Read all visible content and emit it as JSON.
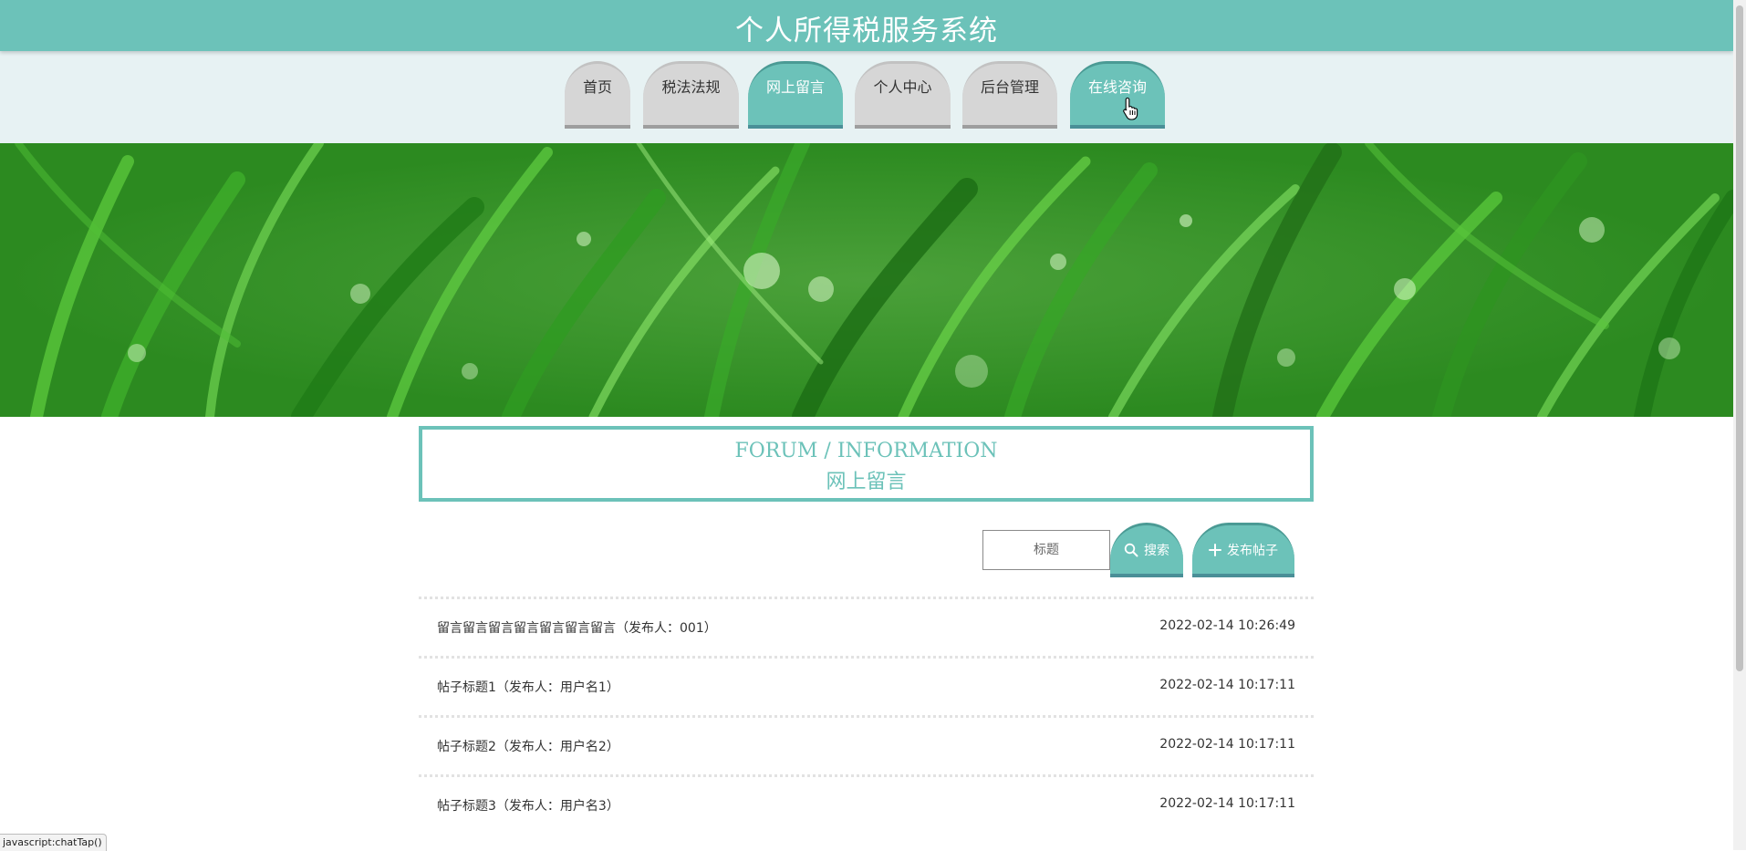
{
  "header": {
    "title": "个人所得税服务系统"
  },
  "nav": {
    "tabs": [
      {
        "label": "首页"
      },
      {
        "label": "税法法规"
      },
      {
        "label": "网上留言"
      },
      {
        "label": "个人中心"
      },
      {
        "label": "后台管理"
      },
      {
        "label": "在线咨询"
      }
    ],
    "active": "网上留言"
  },
  "section": {
    "title_en": "FORUM / INFORMATION",
    "title_cn": "网上留言"
  },
  "search": {
    "placeholder": "标题",
    "search_label": "搜索",
    "post_label": "发布帖子"
  },
  "posts": [
    {
      "title": "留言留言留言留言留言留言留言（发布人：001）",
      "date": "2022-02-14 10:26:49"
    },
    {
      "title": "帖子标题1（发布人：用户名1）",
      "date": "2022-02-14 10:17:11"
    },
    {
      "title": "帖子标题2（发布人：用户名2）",
      "date": "2022-02-14 10:17:11"
    },
    {
      "title": "帖子标题3（发布人：用户名3）",
      "date": "2022-02-14 10:17:11"
    }
  ],
  "status_bar": {
    "text": "javascript:chatTap()"
  },
  "colors": {
    "primary": "#6cc2b9",
    "tab_inactive": "#d6d6d6",
    "nav_bg": "#e7f2f3"
  }
}
